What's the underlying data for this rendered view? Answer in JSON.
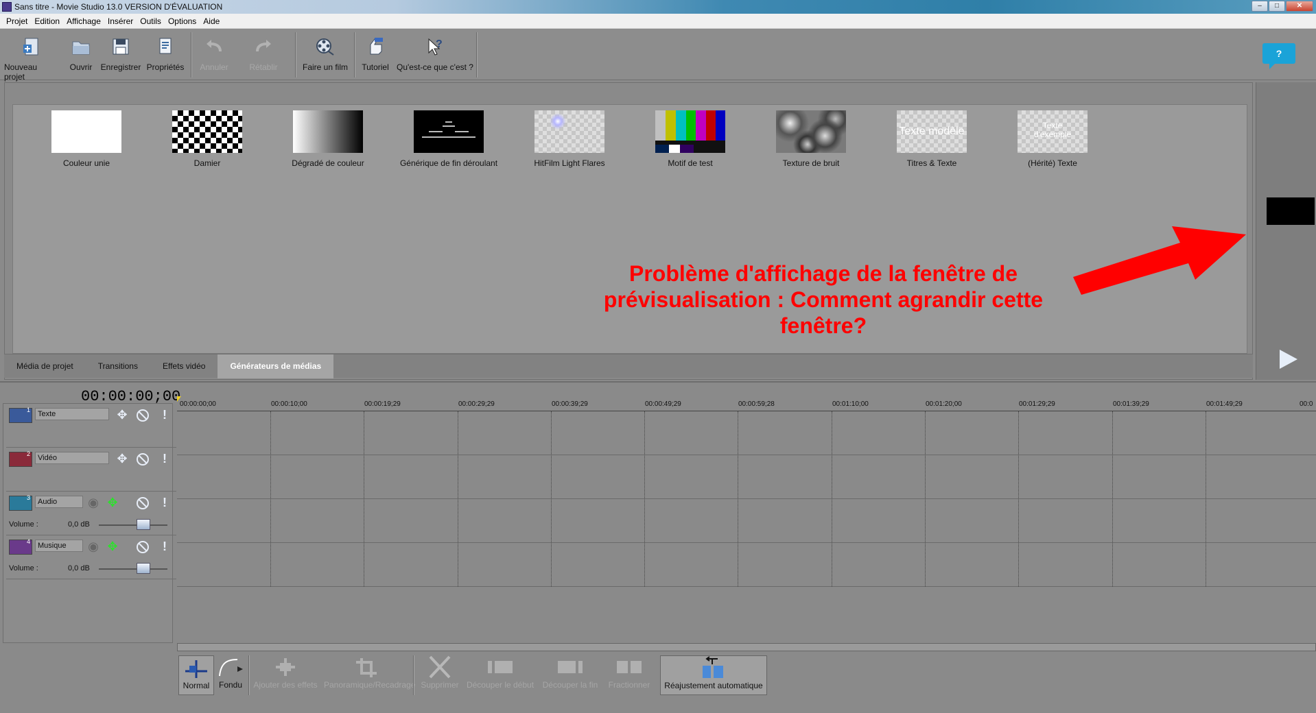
{
  "window": {
    "title": "Sans titre - Movie Studio 13.0 VERSION D'ÉVALUATION",
    "min": "–",
    "max": "□",
    "close": "✕"
  },
  "menu": [
    "Projet",
    "Edition",
    "Affichage",
    "Insérer",
    "Outils",
    "Options",
    "Aide"
  ],
  "toolbar": {
    "new_project": "Nouveau projet",
    "open": "Ouvrir",
    "save": "Enregistrer",
    "properties": "Propriétés",
    "undo": "Annuler",
    "redo": "Rétablir",
    "make_movie": "Faire un film",
    "tutorial": "Tutoriel",
    "whats_this": "Qu'est-ce que c'est ?"
  },
  "help_badge": "?",
  "generators": [
    {
      "label": "Couleur unie"
    },
    {
      "label": "Damier"
    },
    {
      "label": "Dégradé de couleur"
    },
    {
      "label": "Générique de fin déroulant"
    },
    {
      "label": "HitFilm Light Flares"
    },
    {
      "label": "Motif de test"
    },
    {
      "label": "Texture de bruit"
    },
    {
      "label": "Titres & Texte",
      "thumb_text": "Texte modèle"
    },
    {
      "label": "(Hérité) Texte",
      "thumb_text": "Texte d'exemple"
    }
  ],
  "tabs": [
    "Média de projet",
    "Transitions",
    "Effets vidéo",
    "Générateurs de médias"
  ],
  "active_tab": "Générateurs de médias",
  "annotation": "Problème d'affichage de la fenêtre de prévisualisation : Comment agrandir cette fenêtre?",
  "timecode": "00:00:00;00",
  "ruler_ticks": [
    "00:00:00;00",
    "00:00:10;00",
    "00:00:19;29",
    "00:00:29;29",
    "00:00:39;29",
    "00:00:49;29",
    "00:00:59;28",
    "00:01:10;00",
    "00:01:20;00",
    "00:01:29;29",
    "00:01:39;29",
    "00:01:49;29",
    "00:0"
  ],
  "tracks": [
    {
      "num": "1",
      "name": "Texte",
      "type": "video",
      "color": "#3a5a9a"
    },
    {
      "num": "2",
      "name": "Vidéo",
      "type": "video",
      "color": "#8a2a3a"
    },
    {
      "num": "3",
      "name": "Audio",
      "type": "audio",
      "color": "#2a7a9a",
      "volume_label": "Volume :",
      "volume": "0,0 dB"
    },
    {
      "num": "4",
      "name": "Musique",
      "type": "audio",
      "color": "#6a3a8a",
      "volume_label": "Volume :",
      "volume": "0,0 dB"
    }
  ],
  "bottom_tools": {
    "normal": "Normal",
    "fade": "Fondu",
    "add_effects": "Ajouter des effets",
    "pan_crop": "Panoramique/Recadrage",
    "delete": "Supprimer",
    "trim_start": "Découper le début",
    "trim_end": "Découper la fin",
    "split": "Fractionner",
    "auto_ripple": "Réajustement automatique"
  }
}
